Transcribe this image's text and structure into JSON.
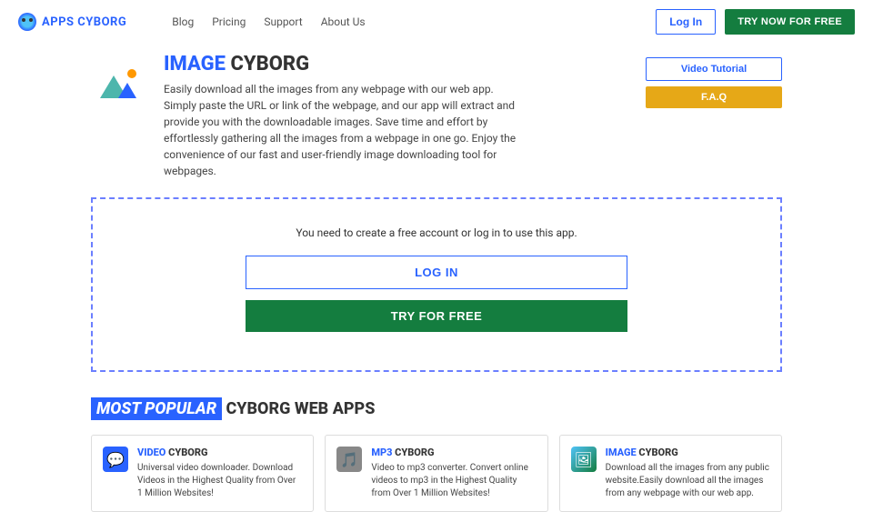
{
  "header": {
    "logo": "APPS CYBORG",
    "nav": [
      "Blog",
      "Pricing",
      "Support",
      "About Us"
    ],
    "login": "Log In",
    "try": "TRY NOW FOR FREE"
  },
  "hero": {
    "title_blue": "IMAGE",
    "title_rest": " CYBORG",
    "desc": "Easily download all the images from any webpage with our web app. Simply paste the URL or link of the webpage, and our app will extract and provide you with the downloadable images. Save time and effort by effortlessly gathering all the images from a webpage in one go. Enjoy the convenience of our fast and user-friendly image downloading tool for webpages.",
    "tutorial": "Video Tutorial",
    "faq": "F.A.Q"
  },
  "cta": {
    "text": "You need to create a free account or log in to use this app.",
    "login": "LOG IN",
    "try": "TRY FOR FREE"
  },
  "section": {
    "hl": "MOST POPULAR",
    "rest": " CYBORG WEB APPS"
  },
  "cards": [
    {
      "title_a": "VIDEO",
      "title_b": " CYBORG",
      "desc": "Universal video downloader. Download Videos in the Highest Quality from Over 1 Million Websites!"
    },
    {
      "title_a": "MP3",
      "title_b": " CYBORG",
      "desc": "Video to mp3 converter. Convert online videos to mp3 in the Highest Quality from Over 1 Million Websites!"
    },
    {
      "title_a": "IMAGE",
      "title_b": " CYBORG",
      "desc": "Download all the images from any public website.Easily download all the images from any webpage with our web app."
    }
  ]
}
